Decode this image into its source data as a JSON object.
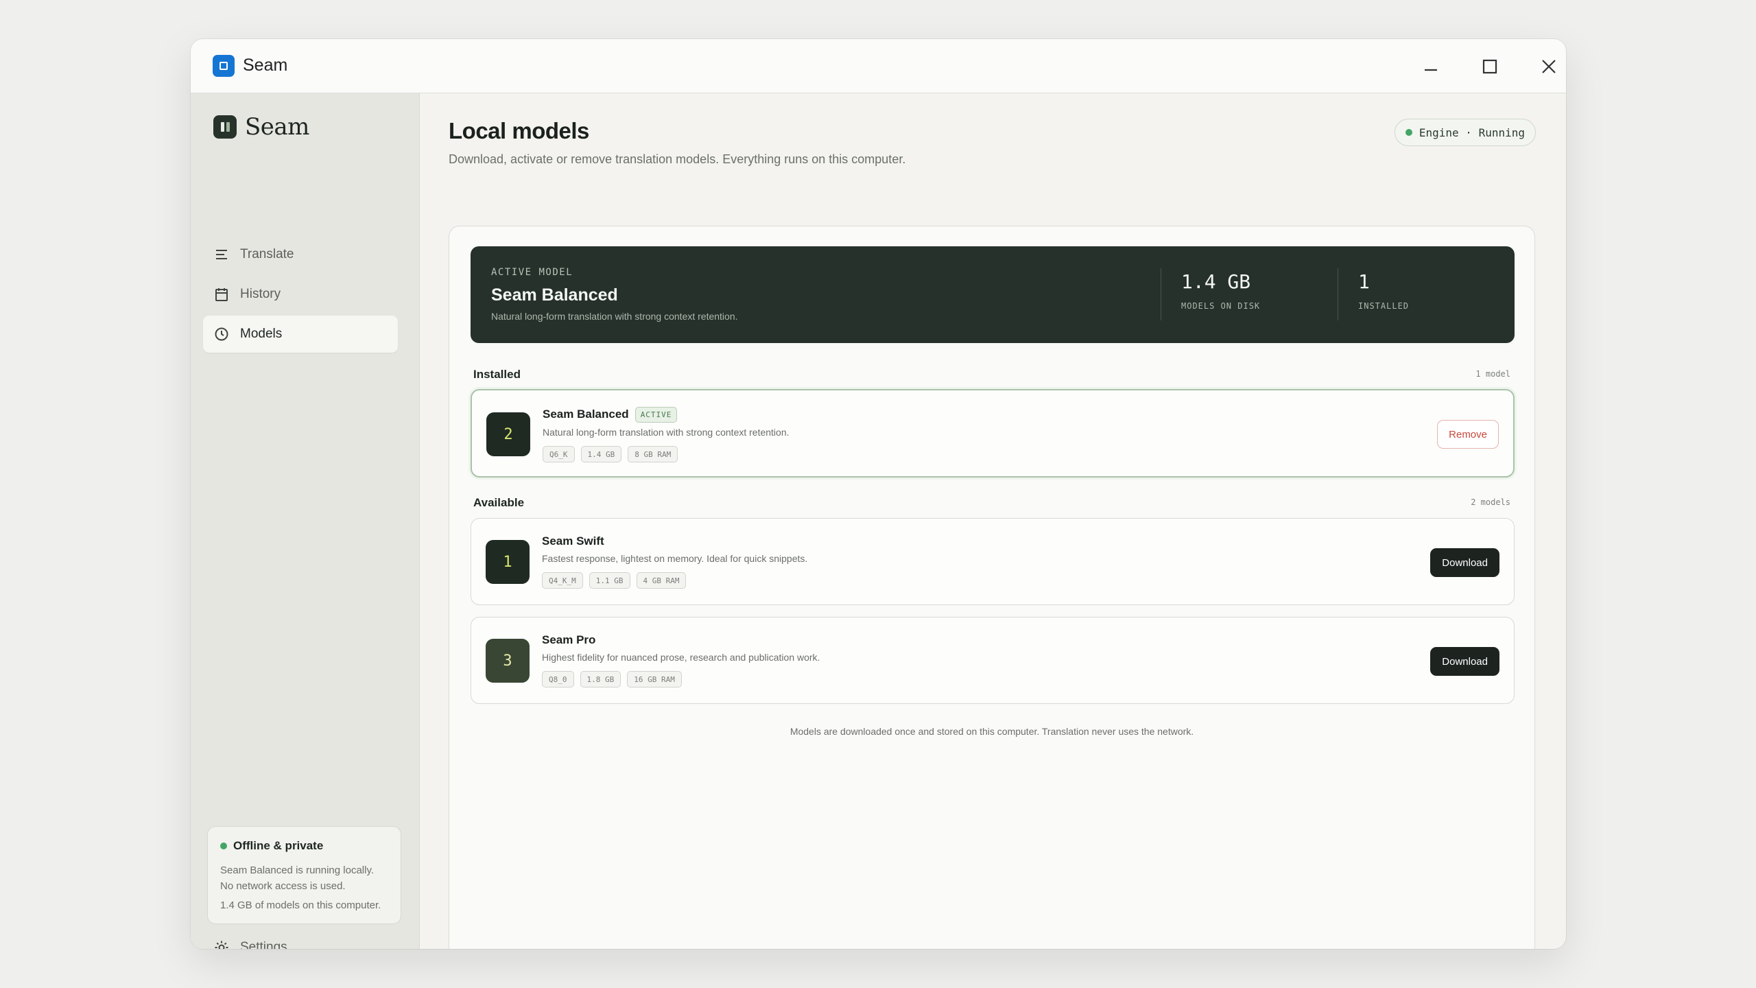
{
  "window": {
    "title": "Seam",
    "icon": "app-square-icon"
  },
  "sidebar": {
    "brand": "Seam",
    "nav": [
      {
        "label": "Translate",
        "icon": "lines-icon",
        "active": false
      },
      {
        "label": "History",
        "icon": "calendar-icon",
        "active": false
      },
      {
        "label": "Models",
        "icon": "clock-icon",
        "active": true
      }
    ],
    "status_card": {
      "title": "Offline & private",
      "line1": "Seam Balanced is running locally.",
      "line2": "No network access is used.",
      "footer": "1.4 GB of models on this computer."
    },
    "settings_label": "Settings"
  },
  "main": {
    "title": "Local models",
    "subtitle": "Download, activate or remove translation models. Everything runs on this computer.",
    "engine_status": "Engine · Running",
    "hero": {
      "kicker": "ACTIVE MODEL",
      "name": "Seam Balanced",
      "description": "Natural long-form translation with strong context retention.",
      "stats": [
        {
          "value": "1.4 GB",
          "label": "MODELS ON DISK"
        },
        {
          "value": "1",
          "label": "INSTALLED"
        }
      ]
    },
    "installed": {
      "label": "Installed",
      "count": "1 model",
      "models": [
        {
          "number": "2",
          "name": "Seam Balanced",
          "tag": "ACTIVE",
          "description": "Natural long-form translation with strong context retention.",
          "chips": [
            "Q6_K",
            "1.4 GB",
            "8 GB RAM"
          ],
          "action": "Remove"
        }
      ]
    },
    "available": {
      "label": "Available",
      "count": "2 models",
      "models": [
        {
          "number": "1",
          "name": "Seam Swift",
          "description": "Fastest response, lightest on memory. Ideal for quick snippets.",
          "chips": [
            "Q4_K_M",
            "1.1 GB",
            "4 GB RAM"
          ],
          "action": "Download"
        },
        {
          "number": "3",
          "name": "Seam Pro",
          "description": "Highest fidelity for nuanced prose, research and publication work.",
          "chips": [
            "Q8_0",
            "1.8 GB",
            "16 GB RAM"
          ],
          "action": "Download"
        }
      ]
    },
    "footer_note": "Models are downloaded once and stored on this computer. Translation never uses the network."
  },
  "colors": {
    "accent_dark": "#26312b",
    "status_green": "#43a566",
    "remove_red": "#c8493a",
    "app_blue": "#1575d3"
  }
}
